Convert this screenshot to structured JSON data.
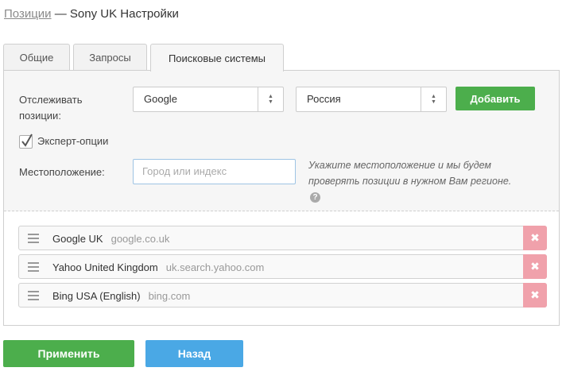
{
  "header": {
    "breadcrumb_link": "Позиции",
    "separator": " — ",
    "title": "Sony UK Настройки"
  },
  "tabs": [
    {
      "label": "Общие",
      "active": false
    },
    {
      "label": "Запросы",
      "active": false
    },
    {
      "label": "Поисковые системы",
      "active": true
    }
  ],
  "form": {
    "track_label_line1": "Отслеживать",
    "track_label_line2": "позиции:",
    "engine_select": "Google",
    "region_select": "Россия",
    "add_button": "Добавить",
    "expert_label": "Эксперт-опции",
    "expert_checked": true,
    "location_label": "Местоположение:",
    "location_placeholder": "Город или индекс",
    "hint": "Укажите местоположение и мы будем проверять позиции в нужном Вам регионе.",
    "help_icon": "?"
  },
  "engines": [
    {
      "name": "Google UK",
      "domain": "google.co.uk"
    },
    {
      "name": "Yahoo United Kingdom",
      "domain": "uk.search.yahoo.com"
    },
    {
      "name": "Bing USA (English)",
      "domain": "bing.com"
    }
  ],
  "buttons": {
    "apply": "Применить",
    "back": "Назад"
  },
  "colors": {
    "green": "#4cae4c",
    "blue": "#4aa8e5",
    "delete": "#f0a1ab"
  }
}
